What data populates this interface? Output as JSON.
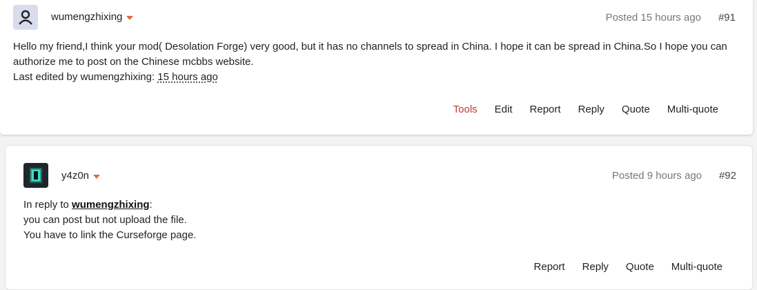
{
  "posts": [
    {
      "author": "wumengzhixing",
      "posted": "Posted 15 hours ago",
      "number": "#91",
      "body_line1": "Hello my friend,I think your mod( Desolation Forge) very good, but it has no channels to spread in China. I hope it can be spread in China.So I hope you can",
      "body_line2": "authorize me to post on the Chinese mcbbs website.",
      "edited_prefix": "Last edited by wumengzhixing: ",
      "edited_time": "15 hours ago",
      "actions": {
        "tools": "Tools",
        "edit": "Edit",
        "report": "Report",
        "reply": "Reply",
        "quote": "Quote",
        "multiquote": "Multi-quote"
      }
    },
    {
      "author": "y4z0n",
      "posted": "Posted 9 hours ago",
      "number": "#92",
      "reply_prefix": "In reply to ",
      "reply_user": "wumengzhixing",
      "reply_suffix": ":",
      "body_line1": "you can post but not upload the file.",
      "body_line2": "You have to link the Curseforge page.",
      "actions": {
        "report": "Report",
        "reply": "Reply",
        "quote": "Quote",
        "multiquote": "Multi-quote"
      }
    }
  ],
  "colors": {
    "accent_caret": "#e06a36",
    "tools_red": "#c0392b"
  }
}
